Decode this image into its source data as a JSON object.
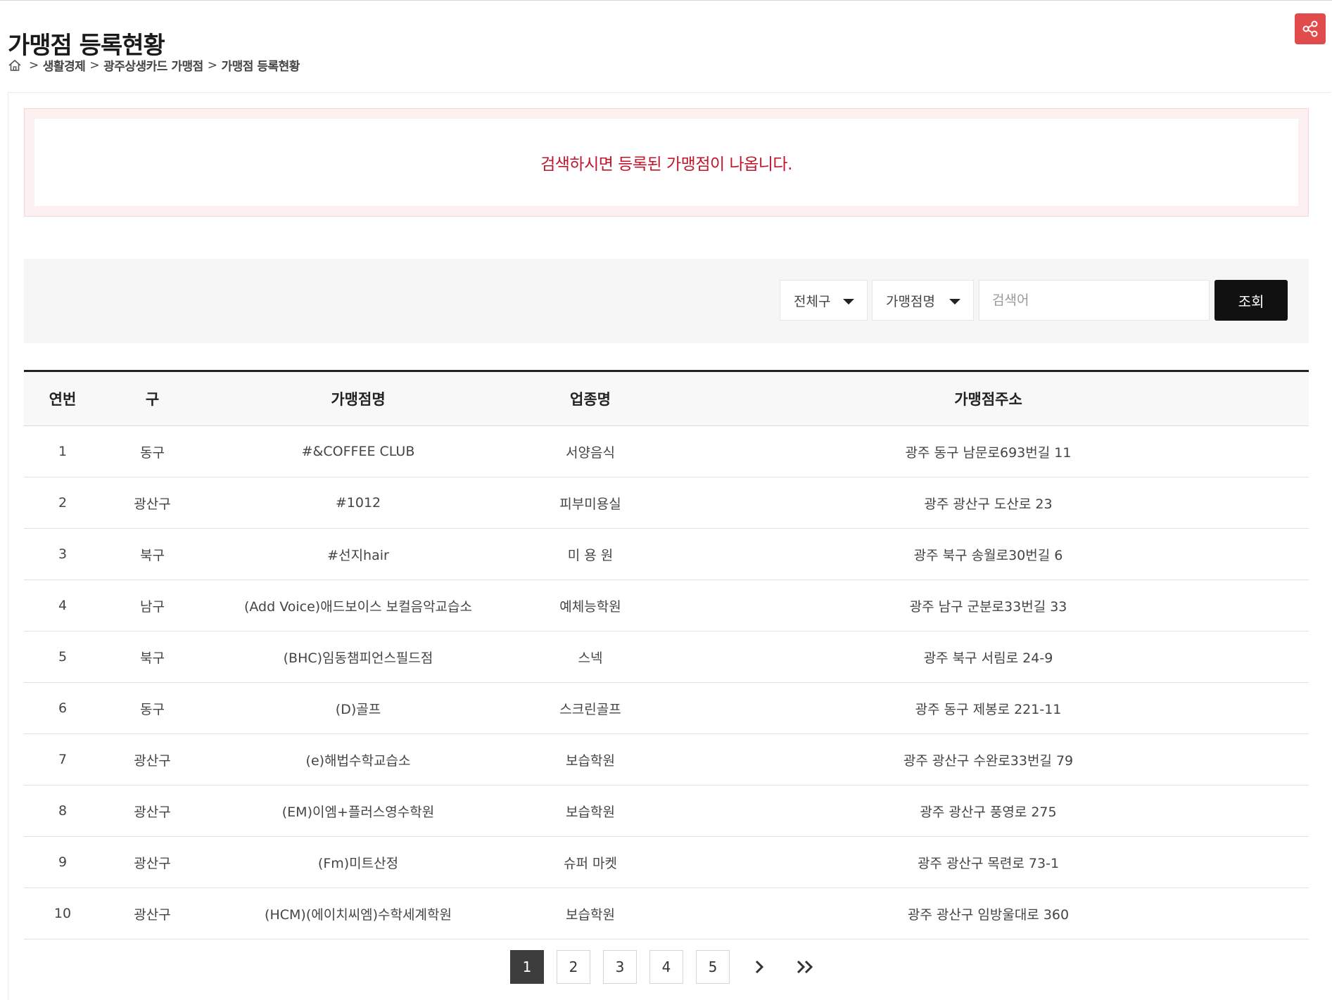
{
  "page": {
    "title": "가맹점 등록현황",
    "breadcrumb": [
      "생활경제",
      "광주상생카드 가맹점",
      "가맹점 등록현황"
    ]
  },
  "icons": {
    "home": "home-icon",
    "share": "share-icon",
    "next": "chevron-right-icon",
    "last": "double-chevron-right-icon"
  },
  "colors": {
    "share_button": "#e24b4b",
    "notice_text": "#c0162b",
    "search_button": "#111111",
    "active_page": "#3d3d3d"
  },
  "notice": {
    "text": "검색하시면 등록된 가맹점이 나옵니다."
  },
  "search": {
    "district_selected": "전체구",
    "field_selected": "가맹점명",
    "placeholder": "검색어",
    "button_label": "조회"
  },
  "table": {
    "headers": [
      "연번",
      "구",
      "가맹점명",
      "업종명",
      "가맹점주소"
    ],
    "rows": [
      [
        "1",
        "동구",
        "#&COFFEE CLUB",
        "서양음식",
        "광주 동구 남문로693번길 11"
      ],
      [
        "2",
        "광산구",
        "#1012",
        "피부미용실",
        "광주 광산구 도산로 23"
      ],
      [
        "3",
        "북구",
        "#선지hair",
        "미 용 원",
        "광주 북구 송월로30번길 6"
      ],
      [
        "4",
        "남구",
        "(Add Voice)애드보이스 보컬음악교습소",
        "예체능학원",
        "광주 남구 군분로33번길 33"
      ],
      [
        "5",
        "북구",
        "(BHC)임동챔피언스필드점",
        "스넥",
        "광주 북구 서림로 24-9"
      ],
      [
        "6",
        "동구",
        "(D)골프",
        "스크린골프",
        "광주 동구 제봉로 221-11"
      ],
      [
        "7",
        "광산구",
        "(e)해법수학교습소",
        "보습학원",
        "광주 광산구 수완로33번길 79"
      ],
      [
        "8",
        "광산구",
        "(EM)이엠+플러스영수학원",
        "보습학원",
        "광주 광산구 풍영로 275"
      ],
      [
        "9",
        "광산구",
        "(Fm)미트산정",
        "슈퍼 마켓",
        "광주 광산구 목련로 73-1"
      ],
      [
        "10",
        "광산구",
        "(HCM)(에이치씨엠)수학세계학원",
        "보습학원",
        "광주 광산구 임방울대로 360"
      ]
    ]
  },
  "pagination": {
    "pages": [
      "1",
      "2",
      "3",
      "4",
      "5"
    ],
    "current": "1"
  }
}
